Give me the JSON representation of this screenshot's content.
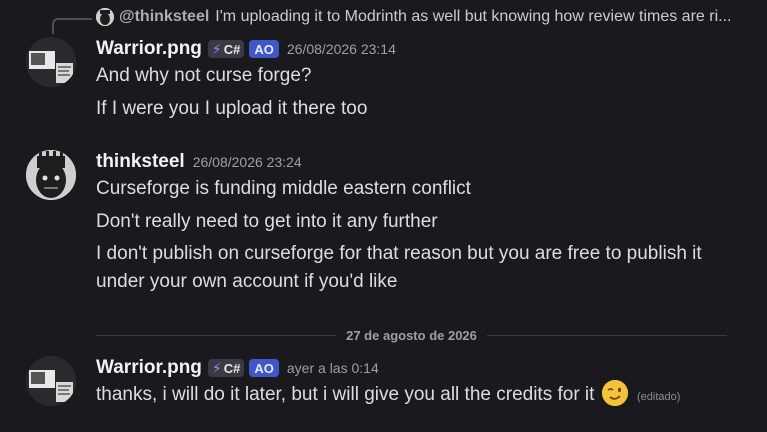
{
  "reply": {
    "username": "@thinksteel",
    "text": "I'm uploading it to Modrinth as well but knowing how review times are ri..."
  },
  "messages": [
    {
      "username": "Warrior.png",
      "tag": "C#",
      "role_badge": "AO",
      "timestamp": "26/08/2026 23:14",
      "lines": [
        "And why not curse forge?",
        "If I were you I upload it there too"
      ]
    },
    {
      "username": "thinksteel",
      "timestamp": "26/08/2026 23:24",
      "lines": [
        "Curseforge is funding middle eastern conflict",
        "Don't really need to get into it any further",
        "I don't publish on curseforge for that reason but you are free to publish it under your own account if you'd like"
      ]
    },
    {
      "username": "Warrior.png",
      "tag": "C#",
      "role_badge": "AO",
      "timestamp": "ayer a las 0:14",
      "lines": [
        "thanks, i will do it later, but i will give you all the credits for it"
      ],
      "edited_label": "(editado)",
      "emoji": "winking-face-emoji"
    }
  ],
  "date_divider": "27 de agosto de 2026",
  "colors": {
    "background": "#1a1a1e",
    "ao_badge": "#3f57c8",
    "tag_bolt": "#b07cf0"
  }
}
